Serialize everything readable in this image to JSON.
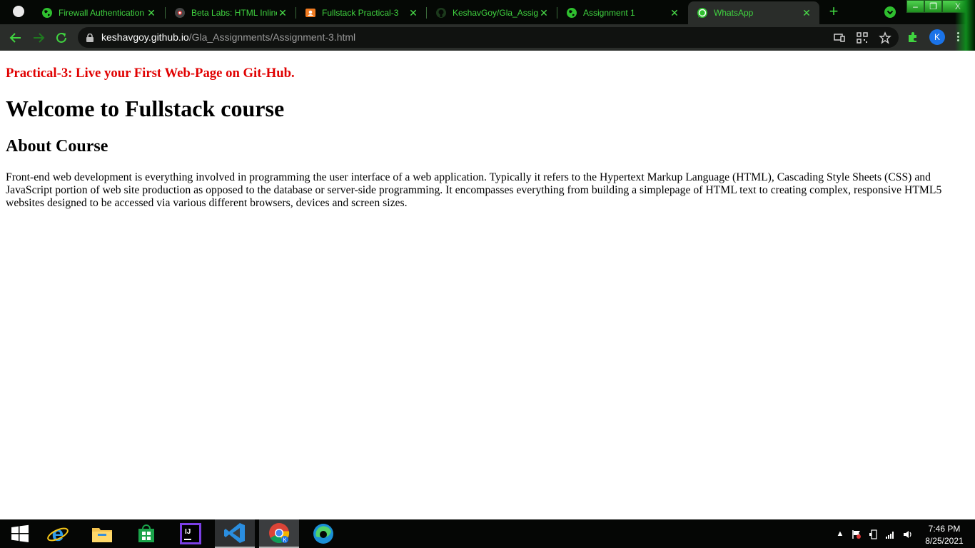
{
  "browser": {
    "tabs": [
      {
        "label": "Firewall Authentication",
        "icon": "globe-icon",
        "active": false
      },
      {
        "label": "Beta Labs: HTML Inline",
        "icon": "beta-labs-icon",
        "active": false
      },
      {
        "label": "Fullstack Practical-3",
        "icon": "classroom-icon",
        "active": false
      },
      {
        "label": "KeshavGoy/Gla_Assignments",
        "icon": "github-icon",
        "active": false
      },
      {
        "label": "Assignment 1",
        "icon": "globe-icon",
        "active": false
      },
      {
        "label": "WhatsApp",
        "icon": "whatsapp-icon",
        "active": true
      }
    ],
    "new_tab_label": "+",
    "window_controls": {
      "minimize": "–",
      "maximize": "❐",
      "close": "X"
    },
    "url_host": "keshavgoy.github.io",
    "url_path": "/Gla_Assignments/Assignment-3.html",
    "profile_initial": "K",
    "accent_color": "#40d440"
  },
  "page": {
    "practical_heading": "Practical-3: Live your First Web-Page on Git-Hub.",
    "main_heading": "Welcome to Fullstack course",
    "sub_heading": "About Course",
    "about_text": "Front-end web development is everything involved in programming the user interface of a web application. Typically it refers to the Hypertext Markup Language (HTML), Cascading Style Sheets (CSS) and JavaScript portion of web site production as opposed to the database or server-side programming. It encompasses everything from building a simplepage of HTML text to creating complex, responsive HTML5 websites designed to be accessed via various different browsers, devices and screen sizes.",
    "heading_color": "#e00000"
  },
  "taskbar": {
    "apps": [
      "windows-start-icon",
      "internet-explorer-icon",
      "file-explorer-icon",
      "microsoft-store-icon",
      "intellij-icon",
      "vscode-icon",
      "chrome-icon",
      "edge-icon"
    ],
    "intellij_label": "IJ",
    "time": "7:46 PM",
    "date": "8/25/2021"
  }
}
